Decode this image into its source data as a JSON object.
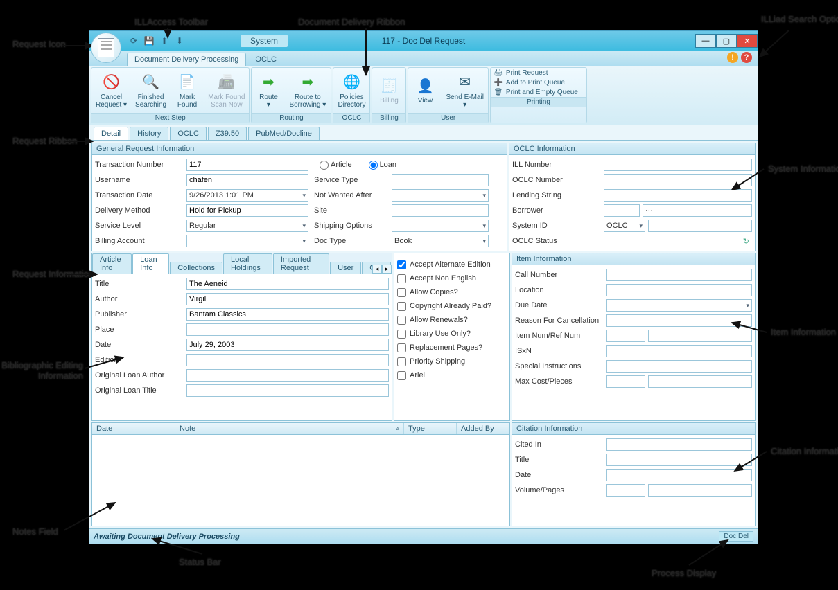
{
  "window": {
    "title": "117 - Doc Del Request",
    "system_tab": "System"
  },
  "ribbon_tabs": [
    "Document Delivery Processing",
    "OCLC"
  ],
  "ribbon": {
    "next_step": {
      "label": "Next Step",
      "buttons": [
        "Cancel Request",
        "Finished Searching",
        "Mark Found",
        "Mark Found Scan Now"
      ]
    },
    "routing": {
      "label": "Routing",
      "buttons": [
        "Route",
        "Route to Borrowing"
      ]
    },
    "oclc": {
      "label": "OCLC",
      "buttons": [
        "Policies Directory"
      ]
    },
    "billing": {
      "label": "Billing",
      "buttons": [
        "Billing"
      ]
    },
    "user": {
      "label": "User",
      "buttons": [
        "View",
        "Send E-Mail"
      ]
    },
    "printing": {
      "label": "Printing",
      "items": [
        "Print Request",
        "Add to Print Queue",
        "Print and Empty Queue"
      ]
    }
  },
  "page_tabs": [
    "Detail",
    "History",
    "OCLC",
    "Z39.50",
    "PubMed/Docline"
  ],
  "general": {
    "header": "General Request Information",
    "transaction_number_label": "Transaction Number",
    "transaction_number": "117",
    "type_article": "Article",
    "type_loan": "Loan",
    "type_selected": "loan",
    "username_label": "Username",
    "username": "chafen",
    "service_type_label": "Service Type",
    "transaction_date_label": "Transaction Date",
    "transaction_date": "9/26/2013 1:01 PM",
    "not_wanted_after_label": "Not Wanted After",
    "delivery_method_label": "Delivery Method",
    "delivery_method": "Hold for Pickup",
    "site_label": "Site",
    "service_level_label": "Service Level",
    "service_level": "Regular",
    "shipping_options_label": "Shipping Options",
    "billing_account_label": "Billing Account",
    "doc_type_label": "Doc Type",
    "doc_type": "Book"
  },
  "oclc_info": {
    "header": "OCLC Information",
    "ill_number": "ILL Number",
    "oclc_number": "OCLC Number",
    "lending_string": "Lending String",
    "borrower": "Borrower",
    "system_id": "System ID",
    "system_id_value": "OCLC",
    "oclc_status": "OCLC Status"
  },
  "inner_tabs": [
    "Article Info",
    "Loan Info",
    "Collections",
    "Local Holdings",
    "Imported Request",
    "User",
    "Copy"
  ],
  "loan_info": {
    "title_label": "Title",
    "title": "The Aeneid",
    "author_label": "Author",
    "author": "Virgil",
    "publisher_label": "Publisher",
    "publisher": "Bantam Classics",
    "place_label": "Place",
    "place": "",
    "date_label": "Date",
    "date": "July 29, 2003",
    "edition_label": "Edition",
    "edition": "",
    "orig_author_label": "Original Loan Author",
    "orig_title_label": "Original Loan Title"
  },
  "flags": {
    "accept_alternate": "Accept Alternate Edition",
    "accept_non_english": "Accept Non English",
    "allow_copies": "Allow Copies?",
    "copyright_paid": "Copyright Already Paid?",
    "allow_renewals": "Allow Renewals?",
    "library_use": "Library Use Only?",
    "replacement": "Replacement Pages?",
    "priority_shipping": "Priority Shipping",
    "ariel": "Ariel",
    "checked": [
      "accept_alternate"
    ]
  },
  "item_info": {
    "header": "Item Information",
    "call_number": "Call Number",
    "location": "Location",
    "due_date": "Due Date",
    "reason_cancel": "Reason For Cancellation",
    "item_num": "Item Num/Ref Num",
    "isxn": "ISxN",
    "special": "Special Instructions",
    "max_cost": "Max Cost/Pieces"
  },
  "notes_grid": {
    "date": "Date",
    "note": "Note",
    "type": "Type",
    "added_by": "Added By"
  },
  "citation": {
    "header": "Citation Information",
    "cited_in": "Cited In",
    "title": "Title",
    "date": "Date",
    "volume": "Volume/Pages"
  },
  "status": {
    "text": "Awaiting Document Delivery Processing",
    "process": "Doc Del"
  },
  "annotations": {
    "request_icon": "Request Icon",
    "ill_access_toolbar": "ILLAccess Toolbar",
    "document_delivery_ribbon": "Document Delivery Ribbon",
    "illiad_search_options": "ILLiad Search Options",
    "request_ribbon": "Request Ribbon",
    "request_information": "Request Information",
    "bibliographic_editing": "Bibliographic Editing Information",
    "notes_field": "Notes Field",
    "status_bar": "Status Bar",
    "system_information": "System Information",
    "item_information": "Item Information",
    "citation_information": "Citation Information",
    "process_display": "Process Display"
  }
}
